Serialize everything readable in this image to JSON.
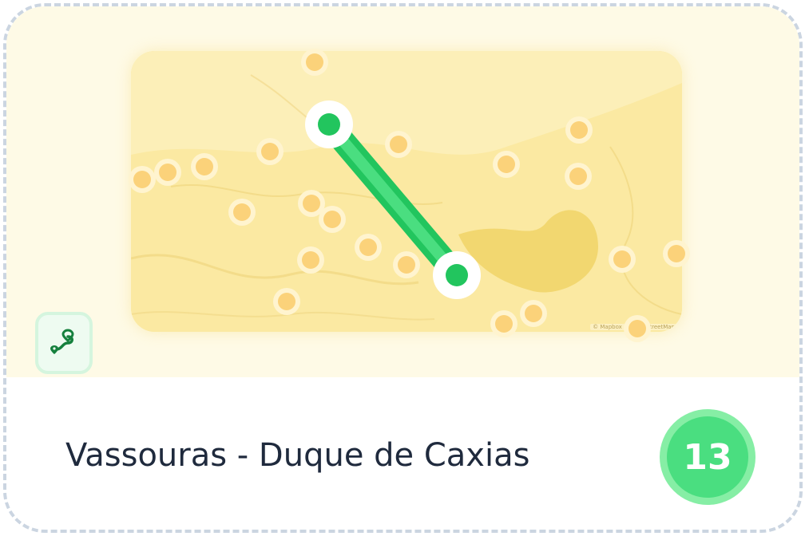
{
  "card": {
    "title": "Vassouras - Duque de Caxias",
    "count": "13",
    "route_icon": "route-icon"
  },
  "map": {
    "attribution": "© Mapbox © OpenStreetMap",
    "route_color": "#22c55e",
    "endpoint_color": "#22c55e",
    "marker_color": "#fbd27a"
  },
  "colors": {
    "border": "#cbd5e1",
    "map_background": "#fbe9a2",
    "area_background": "#fefae6",
    "title": "#1f2a3d",
    "badge_outer": "#86eea5",
    "badge_inner": "#4ade80"
  }
}
